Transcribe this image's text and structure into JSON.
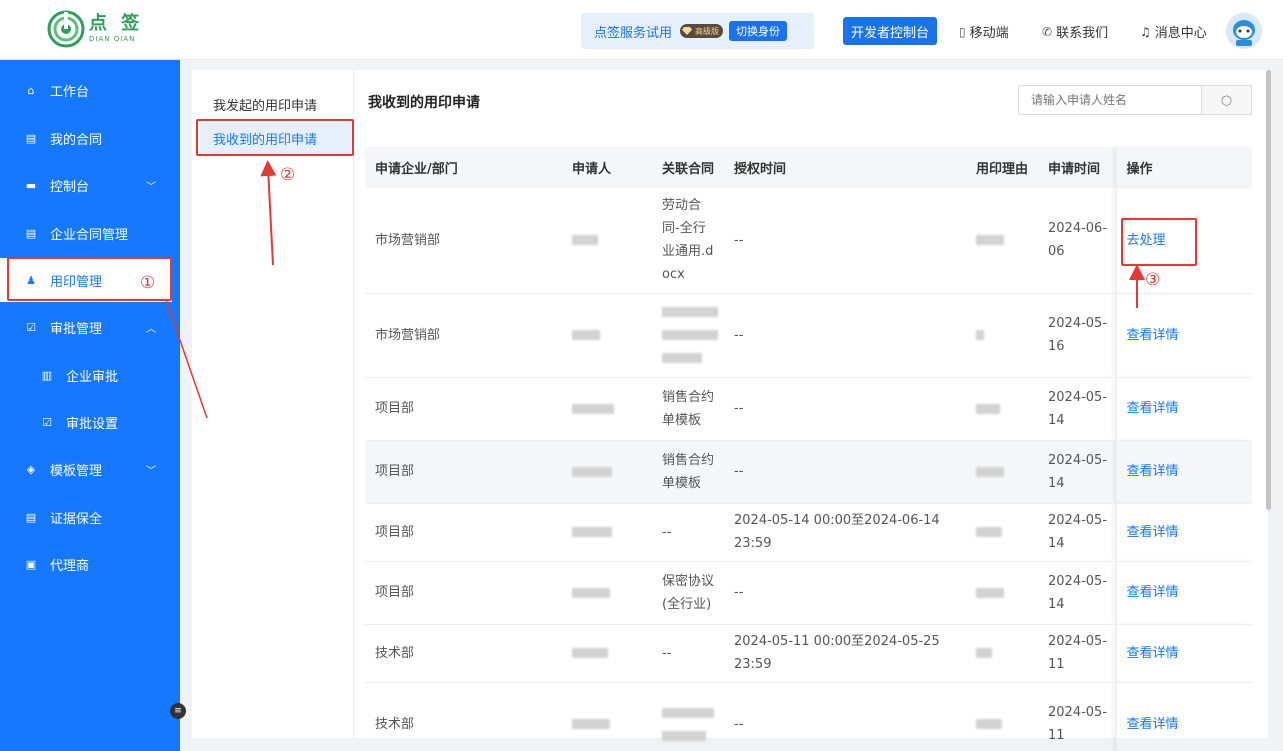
{
  "header": {
    "logo_cn": "点 签",
    "logo_en": "DIAN QIAN",
    "trial_text": "点签服务试用",
    "vip_label": "高级版",
    "switch_label": "切换身份",
    "dev_label": "开发者控制台",
    "links": [
      {
        "label": "移动端",
        "icon": "mobile-icon"
      },
      {
        "label": "联系我们",
        "icon": "phone-icon"
      },
      {
        "label": "消息中心",
        "icon": "bell-icon"
      }
    ],
    "avatar_icon": "user-avatar"
  },
  "sidebar": {
    "items": [
      {
        "label": "工作台",
        "icon": "home-icon"
      },
      {
        "label": "我的合同",
        "icon": "contract-icon"
      },
      {
        "label": "控制台",
        "icon": "console-icon",
        "arrow": "down"
      },
      {
        "label": "企业合同管理",
        "icon": "doc-icon"
      },
      {
        "label": "用印管理",
        "icon": "seal-icon",
        "active": true
      },
      {
        "label": "审批管理",
        "icon": "approve-icon",
        "arrow": "up"
      },
      {
        "label": "企业审批",
        "icon": "building-icon",
        "sub": true
      },
      {
        "label": "审批设置",
        "icon": "checkbox-icon",
        "sub": true
      },
      {
        "label": "模板管理",
        "icon": "layers-icon",
        "arrow": "down"
      },
      {
        "label": "证据保全",
        "icon": "evidence-icon"
      },
      {
        "label": "代理商",
        "icon": "briefcase-icon"
      }
    ]
  },
  "subnav": {
    "items": [
      "我发起的用印申请",
      "我收到的用印申请"
    ]
  },
  "main": {
    "title": "我收到的用印申请",
    "search_placeholder": "请输入申请人姓名",
    "columns": [
      "申请企业/部门",
      "申请人",
      "关联合同",
      "授权时间",
      "用印理由",
      "申请时间",
      "操作"
    ],
    "rows": [
      {
        "dept": "市场营销部",
        "contract": [
          "劳动合",
          "同-全行",
          "业通用.d",
          "ocx"
        ],
        "auth": "--",
        "date": "2024-06-06",
        "op": "去处理"
      },
      {
        "dept": "市场营销部",
        "contract": [],
        "auth": "--",
        "date": "2024-05-16",
        "op": "查看详情"
      },
      {
        "dept": "项目部",
        "contract": [
          "销售合约",
          "单模板"
        ],
        "auth": "--",
        "date": "2024-05-14",
        "op": "查看详情"
      },
      {
        "dept": "项目部",
        "contract": [
          "销售合约",
          "单模板"
        ],
        "auth": "--",
        "date": "2024-05-14",
        "op": "查看详情"
      },
      {
        "dept": "项目部",
        "contract": [
          "--"
        ],
        "auth": "2024-05-14 00:00至2024-06-14 23:59",
        "date": "2024-05-14",
        "op": "查看详情"
      },
      {
        "dept": "项目部",
        "contract": [
          "保密协议",
          "(全行业)"
        ],
        "auth": "--",
        "date": "2024-05-14",
        "op": "查看详情"
      },
      {
        "dept": "技术部",
        "contract": [
          "--"
        ],
        "auth": "2024-05-11 00:00至2024-05-25 23:59",
        "date": "2024-05-11",
        "op": "查看详情"
      },
      {
        "dept": "技术部",
        "contract": [],
        "auth": "--",
        "date": "2024-05-11",
        "op": "查看详情"
      }
    ]
  },
  "annotations": [
    "①",
    "②",
    "③"
  ],
  "colors": {
    "primary": "#1677ff",
    "annotation": "#e53935"
  }
}
